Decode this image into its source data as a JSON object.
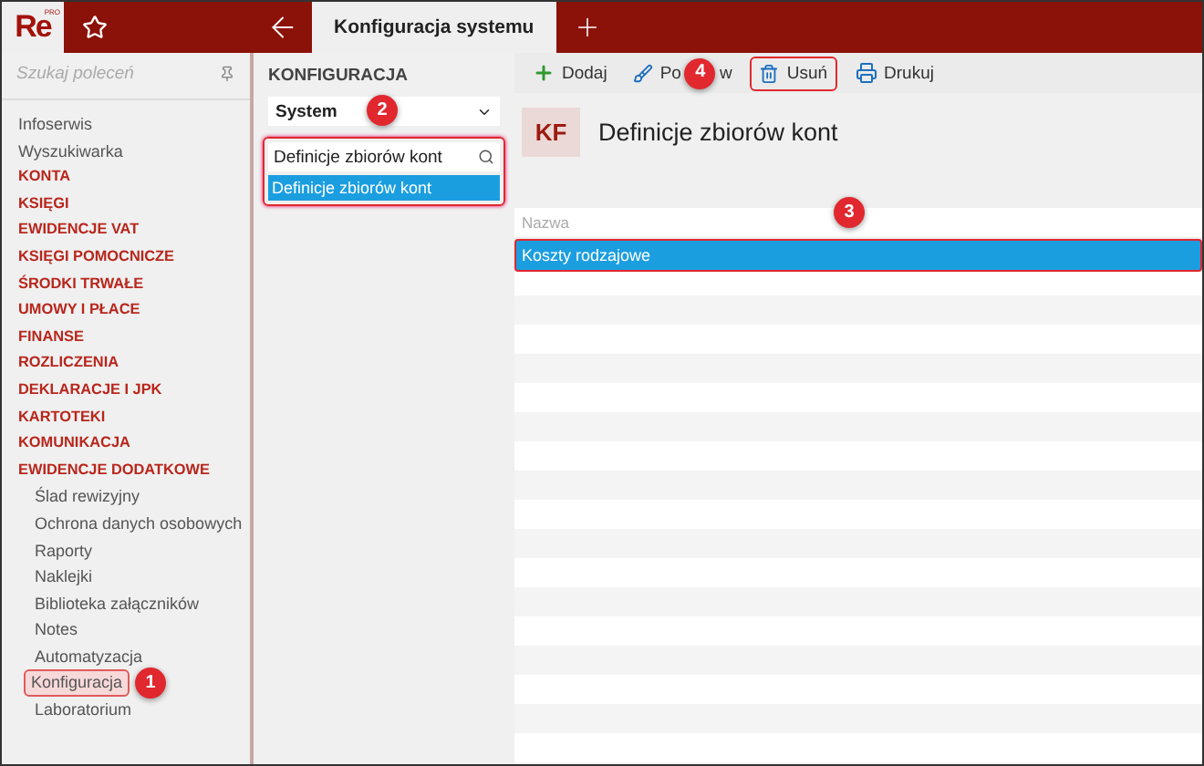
{
  "logo": {
    "text": "Re",
    "badge": "PRO"
  },
  "tab": {
    "title": "Konfiguracja systemu",
    "selected": true
  },
  "sidebar": {
    "search_placeholder": "Szukaj poleceń",
    "items": [
      {
        "kind": "link",
        "label": "Infoserwis"
      },
      {
        "kind": "link",
        "label": "Wyszukiwarka"
      },
      {
        "kind": "section",
        "label": "KONTA"
      },
      {
        "kind": "section",
        "label": "KSIĘGI"
      },
      {
        "kind": "section",
        "label": "EWIDENCJE VAT"
      },
      {
        "kind": "section",
        "label": "KSIĘGI POMOCNICZE"
      },
      {
        "kind": "section",
        "label": "ŚRODKI TRWAŁE"
      },
      {
        "kind": "section",
        "label": "UMOWY I PŁACE"
      },
      {
        "kind": "section",
        "label": "FINANSE"
      },
      {
        "kind": "section",
        "label": "ROZLICZENIA"
      },
      {
        "kind": "section",
        "label": "DEKLARACJE I JPK"
      },
      {
        "kind": "section",
        "label": "KARTOTEKI"
      },
      {
        "kind": "section",
        "label": "KOMUNIKACJA"
      },
      {
        "kind": "section",
        "label": "EWIDENCJE DODATKOWE"
      },
      {
        "kind": "subitem",
        "label": "Ślad rewizyjny"
      },
      {
        "kind": "subitem",
        "label": "Ochrona danych osobowych"
      },
      {
        "kind": "subitem",
        "label": "Raporty"
      },
      {
        "kind": "subitem",
        "label": "Naklejki"
      },
      {
        "kind": "subitem",
        "label": "Biblioteka załączników"
      },
      {
        "kind": "subitem",
        "label": "Notes"
      },
      {
        "kind": "subitem",
        "label": "Automatyzacja"
      },
      {
        "kind": "subitem",
        "label": "Konfiguracja",
        "highlighted": true,
        "callout": "1"
      },
      {
        "kind": "subitem",
        "label": "Laboratorium"
      }
    ]
  },
  "config_panel": {
    "heading": "KONFIGURACJA",
    "dropdown": "System",
    "search_value": "Definicje zbiorów kont",
    "results": [
      {
        "label": "Definicje zbiorów kont",
        "selected": true
      }
    ],
    "highlighted": true,
    "callout": "2"
  },
  "toolbar": [
    {
      "kind": "add",
      "label": "Dodaj",
      "highlighted": false
    },
    {
      "kind": "edit",
      "label_parts": [
        "Po",
        "w"
      ],
      "highlighted": false
    },
    {
      "kind": "delete",
      "label": "Usuń",
      "highlighted": true,
      "callout": "4"
    },
    {
      "kind": "print",
      "label": "Drukuj",
      "highlighted": false
    }
  ],
  "page": {
    "initials": "KF",
    "title": "Definicje zbiorów kont"
  },
  "table": {
    "columns": [
      "Nazwa"
    ],
    "rows": [
      {
        "cells": [
          "Koszty rodzajowe"
        ],
        "selected": true,
        "highlighted": true,
        "callout": "3"
      }
    ]
  }
}
